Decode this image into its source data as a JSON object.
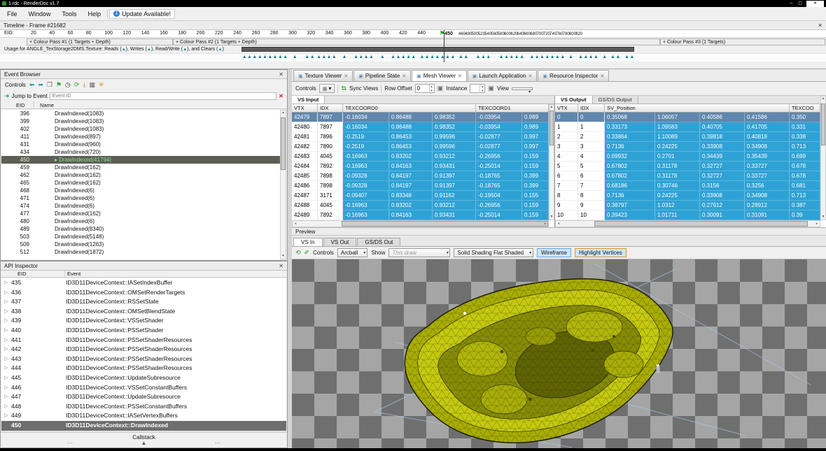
{
  "window": {
    "title": "1.rdc - RenderDoc v1.7"
  },
  "menu": {
    "items": [
      "File",
      "Window",
      "Tools",
      "Help"
    ],
    "update_label": "Update Available!"
  },
  "timeline": {
    "title": "Timeline - Frame #21682",
    "eid_label": "EID:",
    "ticks_before": [
      "20",
      "40",
      "60",
      "80",
      "100",
      "120",
      "140",
      "160",
      "180",
      "200",
      "220",
      "240",
      "260",
      "280",
      "300",
      "320",
      "340",
      "360",
      "380",
      "400",
      "420",
      "440"
    ],
    "current_eid": "450",
    "ticks_after": [
      "460",
      "480",
      "500",
      "520",
      "540",
      "560",
      "580",
      "600",
      "620",
      "640",
      "660",
      "680",
      "700",
      "720",
      "740",
      "760",
      "780",
      "800",
      "820"
    ],
    "passes": [
      "+ Colour Pass #1 (1 Targets + Depth)",
      "+ Colour Pass #2 (1 Targets + Depth)",
      "+ Colour Pass #3 (1 Targets)"
    ],
    "usage_text": "Usage for ANGLE_TexStorage2DMS.Texture: Reads (▲), Writes (▲), Read/Write (▲), and Clears (▲)",
    "marker_clusters": [
      [
        29.3,
        9
      ],
      [
        35.4,
        1
      ],
      [
        36.9,
        2
      ],
      [
        38.3,
        4
      ],
      [
        41.4,
        1
      ],
      [
        42.8,
        4
      ],
      [
        46.0,
        1
      ],
      [
        47.3,
        5
      ],
      [
        50.8,
        7
      ],
      [
        55.5,
        2
      ],
      [
        57.6,
        3
      ],
      [
        60.4,
        5
      ],
      [
        64.1,
        7
      ],
      [
        68.8,
        1
      ],
      [
        70.0,
        4
      ],
      [
        72.9,
        1
      ],
      [
        73.9,
        2
      ],
      [
        75.6,
        2
      ]
    ]
  },
  "event_browser": {
    "title": "Event Browser",
    "controls_label": "Controls",
    "jump_label": "Jump to Event",
    "jump_placeholder": "Event ID",
    "col_eid": "EID",
    "col_name": "Name",
    "selected_eid": "450",
    "rows": [
      {
        "eid": "396",
        "name": "DrawIndexed(1083)"
      },
      {
        "eid": "399",
        "name": "DrawIndexed(1083)"
      },
      {
        "eid": "402",
        "name": "DrawIndexed(1083)"
      },
      {
        "eid": "411",
        "name": "DrawIndexed(897)"
      },
      {
        "eid": "431",
        "name": "DrawIndexed(960)"
      },
      {
        "eid": "434",
        "name": "DrawIndexed(720)"
      },
      {
        "eid": "450",
        "name": "DrawIndexed(41794)"
      },
      {
        "eid": "459",
        "name": "DrawIndexed(162)"
      },
      {
        "eid": "462",
        "name": "DrawIndexed(162)"
      },
      {
        "eid": "465",
        "name": "DrawIndexed(162)"
      },
      {
        "eid": "468",
        "name": "DrawIndexed(6)"
      },
      {
        "eid": "471",
        "name": "DrawIndexed(6)"
      },
      {
        "eid": "474",
        "name": "DrawIndexed(6)"
      },
      {
        "eid": "477",
        "name": "DrawIndexed(162)"
      },
      {
        "eid": "480",
        "name": "DrawIndexed(6)"
      },
      {
        "eid": "489",
        "name": "DrawIndexed(8340)"
      },
      {
        "eid": "503",
        "name": "DrawIndexed(5148)"
      },
      {
        "eid": "509",
        "name": "DrawIndexed(1263)"
      },
      {
        "eid": "512",
        "name": "DrawIndexed(1872)"
      }
    ]
  },
  "api_inspector": {
    "title": "API Inspector",
    "col_eid": "EID",
    "col_event": "Event",
    "selected_eid": "450",
    "callstack_label": "Callstack",
    "rows": [
      {
        "eid": "435",
        "event": "ID3D11DeviceContext::IASetIndexBuffer"
      },
      {
        "eid": "436",
        "event": "ID3D11DeviceContext::OMSetRenderTargets"
      },
      {
        "eid": "437",
        "event": "ID3D11DeviceContext::RSSetState"
      },
      {
        "eid": "438",
        "event": "ID3D11DeviceContext::OMSetBlendState"
      },
      {
        "eid": "439",
        "event": "ID3D11DeviceContext::VSSetShader"
      },
      {
        "eid": "440",
        "event": "ID3D11DeviceContext::PSSetShader"
      },
      {
        "eid": "441",
        "event": "ID3D11DeviceContext::PSSetShaderResources"
      },
      {
        "eid": "442",
        "event": "ID3D11DeviceContext::PSSetShaderResources"
      },
      {
        "eid": "443",
        "event": "ID3D11DeviceContext::PSSetShaderResources"
      },
      {
        "eid": "444",
        "event": "ID3D11DeviceContext::PSSetShaderResources"
      },
      {
        "eid": "445",
        "event": "ID3D11DeviceContext::UpdateSubresource"
      },
      {
        "eid": "446",
        "event": "ID3D11DeviceContext::VSSetConstantBuffers"
      },
      {
        "eid": "447",
        "event": "ID3D11DeviceContext::UpdateSubresource"
      },
      {
        "eid": "448",
        "event": "ID3D11DeviceContext::PSSetConstantBuffers"
      },
      {
        "eid": "449",
        "event": "ID3D11DeviceContext::IASetVertexBuffers"
      },
      {
        "eid": "450",
        "event": "ID3D11DeviceContext::DrawIndexed"
      }
    ]
  },
  "doc_tabs": {
    "tabs": [
      "Texture Viewer",
      "Pipeline State",
      "Mesh Viewer",
      "Launch Application",
      "Resource Inspector"
    ],
    "active": "Mesh Viewer"
  },
  "mesh_toolbar": {
    "controls_label": "Controls",
    "sync_label": "Sync Views",
    "row_offset_label": "Row Offset",
    "row_offset_value": "0",
    "instance_label": "Instance",
    "view_label": "View"
  },
  "vs_input": {
    "title": "VS Input",
    "col_vtx": "VTX",
    "col_idx": "IDX",
    "col_tc0": "TEXCOORD0",
    "col_tc1": "TEXCOORD1",
    "selected_row": 0,
    "rows": [
      [
        "42479",
        "7897",
        "-0.16034",
        "0.86488",
        "0.98352",
        "-0.03954",
        "0.989"
      ],
      [
        "42480",
        "7897",
        "-0.16034",
        "0.86488",
        "0.98352",
        "-0.03954",
        "0.989"
      ],
      [
        "42481",
        "7896",
        "-0.2519",
        "0.86453",
        "0.99596",
        "-0.02877",
        "0.997"
      ],
      [
        "42482",
        "7890",
        "-0.2519",
        "0.86453",
        "0.99596",
        "-0.02877",
        "0.997"
      ],
      [
        "42483",
        "4045",
        "-0.16963",
        "0.83202",
        "0.93212",
        "-0.26956",
        "0.159"
      ],
      [
        "42484",
        "7892",
        "-0.16963",
        "0.84163",
        "0.93431",
        "-0.25014",
        "0.159"
      ],
      [
        "42485",
        "7898",
        "-0.09328",
        "0.84197",
        "0.91397",
        "-0.18765",
        "0.399"
      ],
      [
        "42486",
        "7898",
        "-0.09328",
        "0.84197",
        "0.91397",
        "-0.18765",
        "0.399"
      ],
      [
        "42487",
        "3171",
        "-0.09407",
        "0.83348",
        "0.91162",
        "-0.19504",
        "0.155"
      ],
      [
        "42488",
        "4045",
        "-0.16963",
        "0.83202",
        "0.93212",
        "-0.26956",
        "0.159"
      ],
      [
        "42489",
        "7892",
        "-0.16963",
        "0.84163",
        "0.93431",
        "-0.25014",
        "0.159"
      ]
    ]
  },
  "vs_output": {
    "tab_vs": "VS Output",
    "tab_gs": "GS/DS Output",
    "col_vtx": "VTX",
    "col_idx": "IDX",
    "col_pos": "SV_Position",
    "col_tc": "TEXCOO",
    "selected_row": 0,
    "rows": [
      [
        "0",
        "0",
        "0.35068",
        "1.06057",
        "0.40586",
        "0.41586",
        "0.350"
      ],
      [
        "1",
        "1",
        "0.33173",
        "1.09583",
        "0.40705",
        "0.41705",
        "0.331"
      ],
      [
        "2",
        "2",
        "0.33864",
        "1.10089",
        "0.39818",
        "0.40818",
        "0.338"
      ],
      [
        "3",
        "3",
        "0.7136",
        "0.24225",
        "0.33908",
        "0.34908",
        "0.713"
      ],
      [
        "4",
        "4",
        "0.69932",
        "0.2701",
        "0.34439",
        "0.35439",
        "0.699"
      ],
      [
        "5",
        "5",
        "0.67802",
        "0.31178",
        "0.32727",
        "0.33727",
        "0.678"
      ],
      [
        "6",
        "6",
        "0.67802",
        "0.31178",
        "0.32727",
        "0.33727",
        "0.678"
      ],
      [
        "7",
        "7",
        "0.68186",
        "0.30746",
        "0.3156",
        "0.3256",
        "0.681"
      ],
      [
        "8",
        "8",
        "0.7136",
        "0.24225",
        "0.33908",
        "0.34908",
        "0.713"
      ],
      [
        "9",
        "9",
        "0.38797",
        "1.0312",
        "0.27912",
        "0.28912",
        "0.387"
      ],
      [
        "10",
        "10",
        "0.39423",
        "1.01711",
        "0.30091",
        "0.31091",
        "0.39"
      ]
    ]
  },
  "preview": {
    "title": "Preview",
    "tabs": [
      "VS In",
      "VS Out",
      "GS/DS Out"
    ],
    "active_tab": "VS In",
    "controls_label": "Controls",
    "camera_mode": "Arcball",
    "show_label": "Show",
    "show_value": "This draw",
    "shading_value": "Solid Shading Flat Shaded",
    "wireframe_label": "Wireframe",
    "highlight_label": "Highlight Vertices"
  },
  "colors": {
    "cell_blue": "#2fa2d5",
    "selection_blue": "#5f87ae",
    "selection_gray": "#6e6e6e",
    "selected_text_green": "#8ce28c",
    "marker_teal": "#17808f",
    "model_yellow": "#b5b900",
    "checker_light": "#a5a5a5",
    "checker_dark": "#6f6f6f"
  }
}
